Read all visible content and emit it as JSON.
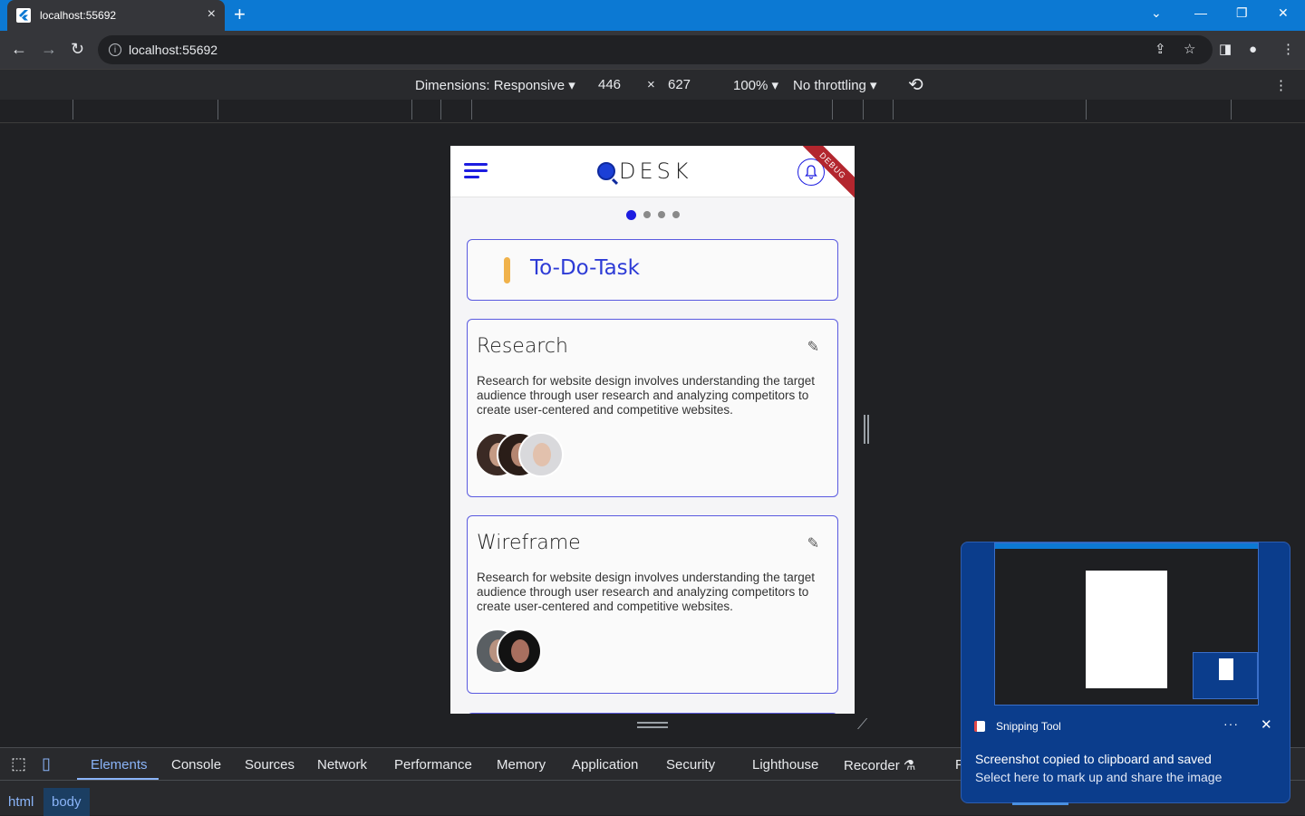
{
  "browser": {
    "tab_title": "localhost:55692",
    "tab_close": "×",
    "new_tab": "+",
    "url": "localhost:55692",
    "win_dropdown": "⌄",
    "win_minimize": "—",
    "win_restore": "❐",
    "win_close": "✕"
  },
  "device_toolbar": {
    "dimensions_label": "Dimensions: Responsive ▾",
    "width": "446",
    "times": "×",
    "height": "627",
    "zoom": "100% ▾",
    "throttling": "No throttling ▾"
  },
  "app": {
    "logo_text": "DESK",
    "debug_banner": "DEBUG",
    "carousel_dots": 4,
    "active_dot": 0,
    "section_title": "To-Do-Task",
    "accent_color": "#2d3bd6",
    "bar_color": "#f0b24b",
    "tasks": [
      {
        "title": "Research",
        "description": "Research for website design involves understanding the target audience through user research and analyzing competitors to create user-centered and competitive websites.",
        "avatar_count": 3
      },
      {
        "title": "Wireframe",
        "description": "Research for website design involves understanding the target audience through user research and analyzing competitors to create user-centered and competitive websites.",
        "avatar_count": 2
      }
    ]
  },
  "devtools": {
    "tabs": [
      "Elements",
      "Console",
      "Sources",
      "Network",
      "Performance",
      "Memory",
      "Application",
      "Security",
      "Lighthouse",
      "Recorder ⚗",
      "P"
    ],
    "active_tab": "Elements",
    "breadcrumbs": [
      "html",
      "body"
    ]
  },
  "toast": {
    "app_name": "Snipping Tool",
    "more": "···",
    "close": "✕",
    "line1": "Screenshot copied to clipboard and saved",
    "line2": "Select here to mark up and share the image"
  }
}
